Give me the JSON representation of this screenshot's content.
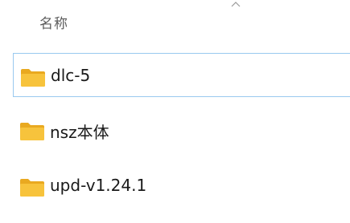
{
  "header": {
    "column_name": "名称",
    "sort_icon": "chevron-up-icon"
  },
  "files": [
    {
      "name": "dlc-5",
      "type": "folder",
      "icon": "folder-icon",
      "selected": true
    },
    {
      "name": "nsz本体",
      "type": "folder",
      "icon": "folder-icon",
      "selected": false
    },
    {
      "name": "upd-v1.24.1",
      "type": "folder",
      "icon": "folder-icon",
      "selected": false
    }
  ],
  "colors": {
    "folder": "#f7c33c",
    "folder_tab": "#e9a920",
    "selection_border": "#99c9ef"
  }
}
